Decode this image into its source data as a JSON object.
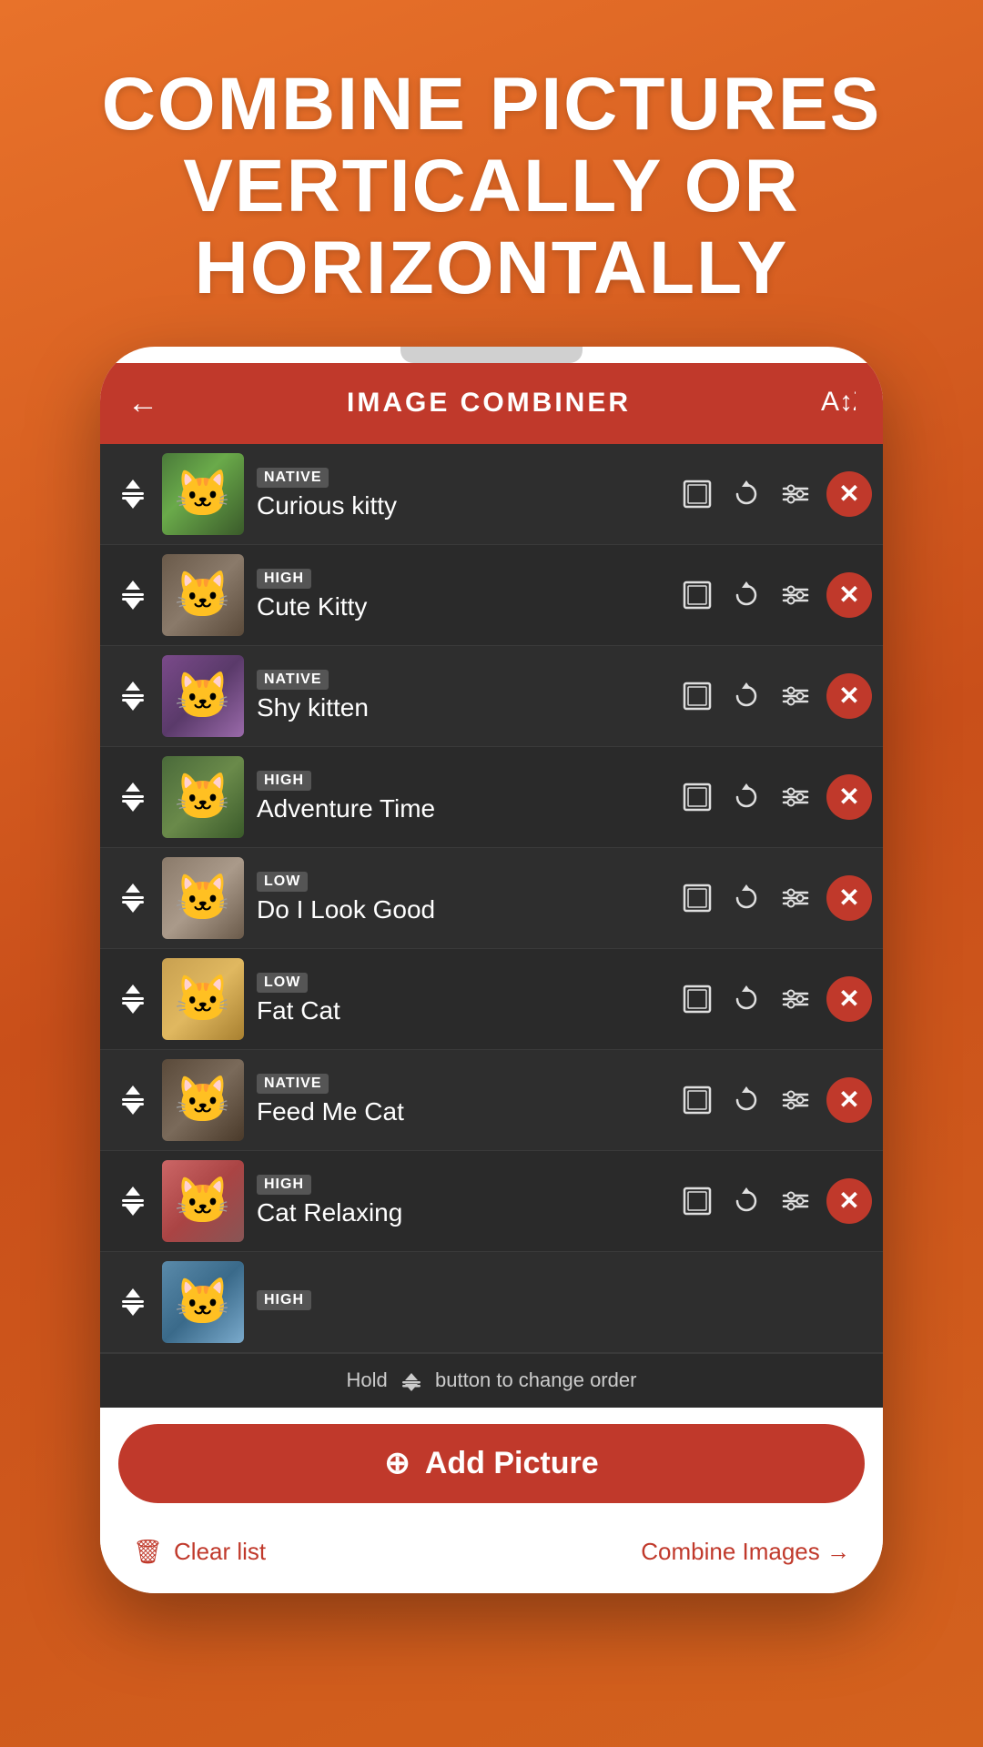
{
  "hero": {
    "line1": "COMBINE PICTURES",
    "line2": "VERTICALLY OR",
    "line3": "HORIZONTALLY"
  },
  "app": {
    "title": "IMAGE COMBINER",
    "back_label": "←",
    "sort_label": "sort"
  },
  "items": [
    {
      "id": 1,
      "quality": "NATIVE",
      "name": "Curious kitty",
      "cat_class": "cat-curious"
    },
    {
      "id": 2,
      "quality": "HIGH",
      "name": "Cute Kitty",
      "cat_class": "cat-cute"
    },
    {
      "id": 3,
      "quality": "NATIVE",
      "name": "Shy kitten",
      "cat_class": "cat-shy"
    },
    {
      "id": 4,
      "quality": "HIGH",
      "name": "Adventure Time",
      "cat_class": "cat-adventure"
    },
    {
      "id": 5,
      "quality": "LOW",
      "name": "Do I Look Good",
      "cat_class": "cat-look"
    },
    {
      "id": 6,
      "quality": "LOW",
      "name": "Fat Cat",
      "cat_class": "cat-fat"
    },
    {
      "id": 7,
      "quality": "NATIVE",
      "name": "Feed Me Cat",
      "cat_class": "cat-feed"
    },
    {
      "id": 8,
      "quality": "HIGH",
      "name": "Cat Relaxing",
      "cat_class": "cat-relax"
    }
  ],
  "partial_item": {
    "quality": "HIGH",
    "cat_class": "cat-partial"
  },
  "hint": {
    "text": "Hold",
    "suffix": "button to change order"
  },
  "add_button": {
    "icon": "⊕",
    "label": "Add Picture"
  },
  "bottom": {
    "clear_label": "Clear list",
    "combine_label": "Combine Images →"
  }
}
